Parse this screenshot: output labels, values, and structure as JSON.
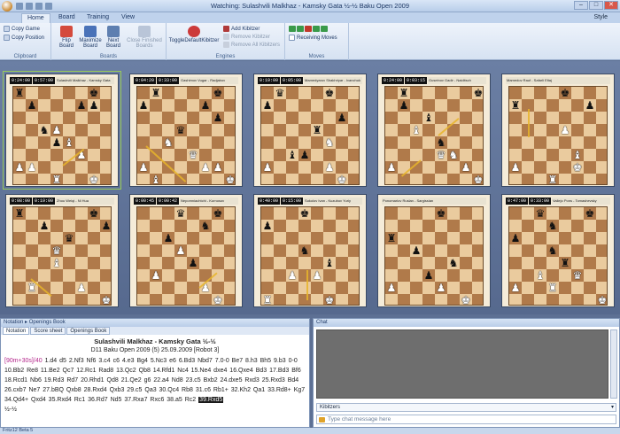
{
  "window": {
    "title": "Watching: Sulashvili Malkhaz - Kamsky Gata  ½-½  Baku Open 2009"
  },
  "ribbon_tabs": [
    {
      "label": "Home",
      "active": true
    },
    {
      "label": "Board",
      "active": false
    },
    {
      "label": "Training",
      "active": false
    },
    {
      "label": "View",
      "active": false
    }
  ],
  "style_menu": "Style",
  "groups": {
    "clipboard": {
      "label": "Clipboard",
      "copy_game": "Copy Game",
      "copy_position": "Copy Position"
    },
    "boards": {
      "label": "Boards",
      "flip": "Flip Board",
      "maximize": "Maximize Board",
      "next": "Next Board",
      "close": "Close Finished Boards"
    },
    "engines": {
      "label": "Engines",
      "toggle": "ToggleDefaultKibitzer",
      "add": "Add Kibitzer",
      "remove": "Remove Kibitzer",
      "remove_all": "Remove All Kibitzers"
    },
    "moves": {
      "label": "Moves",
      "receiving": "Receiving Moves"
    }
  },
  "boards": [
    {
      "clock_white": "0:24:00",
      "clock_black": "0:57:00",
      "players": "Sulashvili Malkhaz - Kamsky Gata"
    },
    {
      "clock_white": "0:04:20",
      "clock_black": "0:33:00",
      "players": "Gashimov Vugar - Radjabov"
    },
    {
      "clock_white": "0:19:00",
      "clock_black": "0:05:00",
      "players": "Mamedyarov Shakhriyar - Ivanchuk"
    },
    {
      "clock_white": "0:24:00",
      "clock_black": "0:03:15",
      "players": "Guseinov Gadir - Naiditsch"
    },
    {
      "clock_white": "",
      "clock_black": "",
      "players": "Mamedov Rauf - Safarli Eltaj"
    },
    {
      "clock_white": "0:08:00",
      "clock_black": "0:19:00",
      "players": "Zhou Weiqi - Ni Hua"
    },
    {
      "clock_white": "0:00:45",
      "clock_black": "0:00:42",
      "players": "Nepomniachtchi - Kurnosov"
    },
    {
      "clock_white": "0:40:00",
      "clock_black": "0:15:00",
      "players": "Sokolov Ivan - Kuzubov Yuriy"
    },
    {
      "clock_white": "",
      "clock_black": "",
      "players": "Ponomariov Ruslan - Sargissian"
    },
    {
      "clock_white": "0:47:00",
      "clock_black": "0:33:00",
      "players": "Vallejo Pons - Tomashevsky"
    }
  ],
  "notation": {
    "panel_title": "Notation ▸ Openings Book",
    "tabs": [
      "Notation",
      "Score sheet",
      "Openings Book"
    ],
    "game_title": "Sulashvili Malkhaz - Kamsky Gata  ½-½",
    "game_info": "D11 Baku Open 2009 (5) 25.09.2009 [Robot 3]",
    "time_control": "[90m+30s]/40",
    "moves": "1.d4 d5 2.Nf3 Nf6 3.c4 c6 4.e3 Bg4 5.Nc3 e6 6.Bd3 Nbd7 7.0-0 Be7 8.h3 Bh5 9.b3 0-0 10.Bb2 Re8 11.Be2 Qc7 12.Rc1 Rad8 13.Qc2 Qb8 14.Rfd1 Nc4 15.Ne4 dxe4 16.Qxe4 Bd3 17.Bd3 Bf6 18.Rcd1 Nb6 19.Rd3 Rd7 20.Rhd1 Qd8 21.Qe2 g6 22.a4 Nd8 23.c5 Bxb2 24.dxe5 Rxd3 25.Rxd3 Bd4 26.cxb7 Ne7 27.bBQ Qxb8 28.Rxd4 Qxb3 29.c5 Qa3 30.Qc4 Rb8 31.c6 Rb1+ 32.Kh2 Qa1 33.Rd8+ Kg7 34.Qd4+ Qxd4 35.Rxd4 Rc1 36.Rd7 Nd5 37.Rxa7 Rxc6 38.a5 Rc2",
    "current_move": "39.Rxd5",
    "result": "½-½"
  },
  "chat": {
    "panel_title": "Chat",
    "kibitzer_select": "Kibitzers",
    "input_placeholder": "Type chat message here"
  },
  "status_bar": "Fritz12 Beta 5"
}
